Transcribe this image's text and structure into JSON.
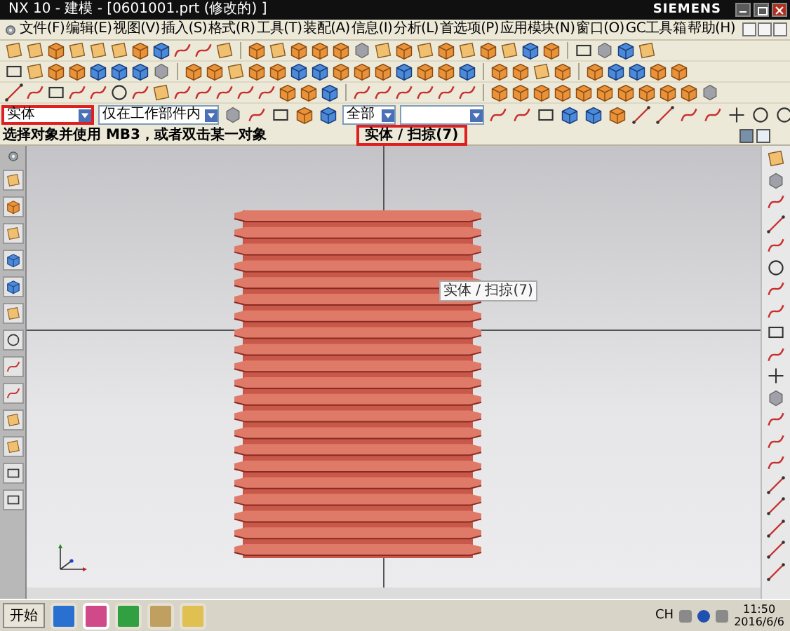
{
  "window": {
    "title": "NX 10 - 建模 - [0601001.prt (修改的) ]",
    "brand": "SIEMENS"
  },
  "menu": [
    {
      "label": "文件(F)"
    },
    {
      "label": "编辑(E)"
    },
    {
      "label": "视图(V)"
    },
    {
      "label": "插入(S)"
    },
    {
      "label": "格式(R)"
    },
    {
      "label": "工具(T)"
    },
    {
      "label": "装配(A)"
    },
    {
      "label": "信息(I)"
    },
    {
      "label": "分析(L)"
    },
    {
      "label": "首选项(P)"
    },
    {
      "label": "应用模块(N)"
    },
    {
      "label": "窗口(O)"
    },
    {
      "label": "GC工具箱"
    },
    {
      "label": "帮助(H)"
    }
  ],
  "selection_bar": {
    "filters": [
      {
        "kind": "dropdown",
        "value": "实体",
        "highlighted": true
      },
      {
        "kind": "dropdown",
        "value": "仅在工作部件内",
        "highlighted": false
      },
      {
        "kind": "dropdown",
        "value": "全部",
        "highlighted": false
      },
      {
        "kind": "dropdown",
        "highlighted": false
      }
    ]
  },
  "status_bar": {
    "prompt": "选择对象并使用 MB3，或者双击某一对象",
    "selection": {
      "text": "实体 / 扫掠(7)",
      "highlighted": true
    }
  },
  "tooltip": {
    "text": "实体 / 扫掠(7)"
  },
  "taskbar": {
    "start": "开始",
    "language": "CH",
    "time": "11:50",
    "date": "2016/6/6"
  }
}
